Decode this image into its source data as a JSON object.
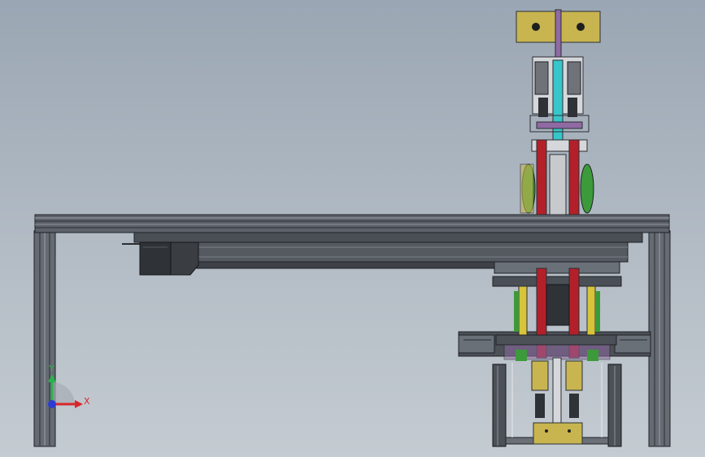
{
  "triad": {
    "x_label": "X",
    "y_label": "Y",
    "x_color": "#d9262b",
    "y_color": "#2bb24c",
    "z_color": "#2a3bd6"
  },
  "colors": {
    "background_top": "#9aa6b3",
    "background_bottom": "#c4cbd1",
    "frame": "#5b6069",
    "frame_dark": "#2b2e33",
    "motor": "#c8b550",
    "rod_red": "#b3202a",
    "rod_cyan": "#37c6c9",
    "rod_yellow": "#d8c43b",
    "rod_green": "#3d9a3a",
    "bracket_purple": "#8f6aa3"
  }
}
